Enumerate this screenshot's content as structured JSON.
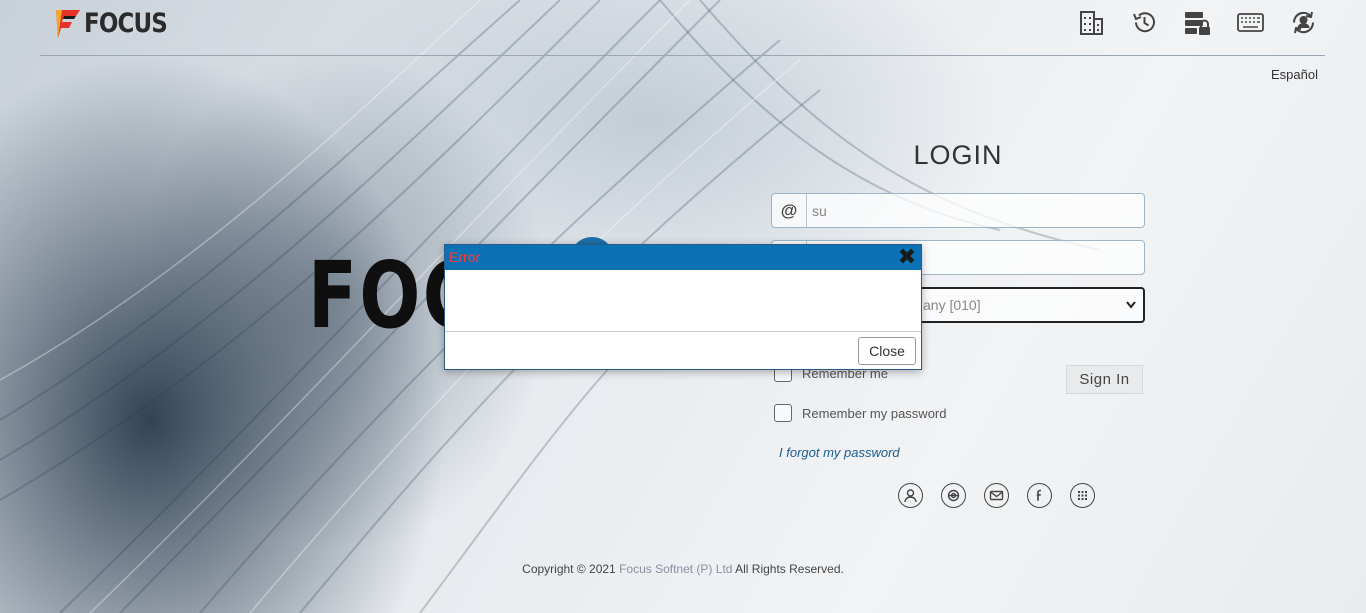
{
  "header": {
    "brand": "FOCUS",
    "toolbar_icons": [
      "building-icon",
      "history-icon",
      "server-lock-icon",
      "keyboard-icon",
      "user-sync-icon"
    ]
  },
  "language_link": "Español",
  "hero_logo": "FOC",
  "login": {
    "title": "LOGIN",
    "username_addon": "@",
    "username_value": "su",
    "password_value": "",
    "company_value": "any [010]",
    "remember_me": "Remember me",
    "remember_password": "Remember my password",
    "signin_label": "Sign In",
    "forgot_label": "I forgot my password",
    "social_icons": [
      "user-icon",
      "support-icon",
      "mail-icon",
      "facebook-icon",
      "apps-icon"
    ]
  },
  "footer": {
    "prefix": "Copyright © 2021 ",
    "company": "Focus Softnet (P) Ltd",
    "suffix": " All Rights Reserved."
  },
  "dialog": {
    "title": "Error",
    "close_x": "✖",
    "body": "",
    "close_label": "Close"
  },
  "colors": {
    "dialog_title_bg": "#0a72b4",
    "dialog_title_text": "#ff3a3a",
    "forgot_link": "#1f5d8c"
  }
}
